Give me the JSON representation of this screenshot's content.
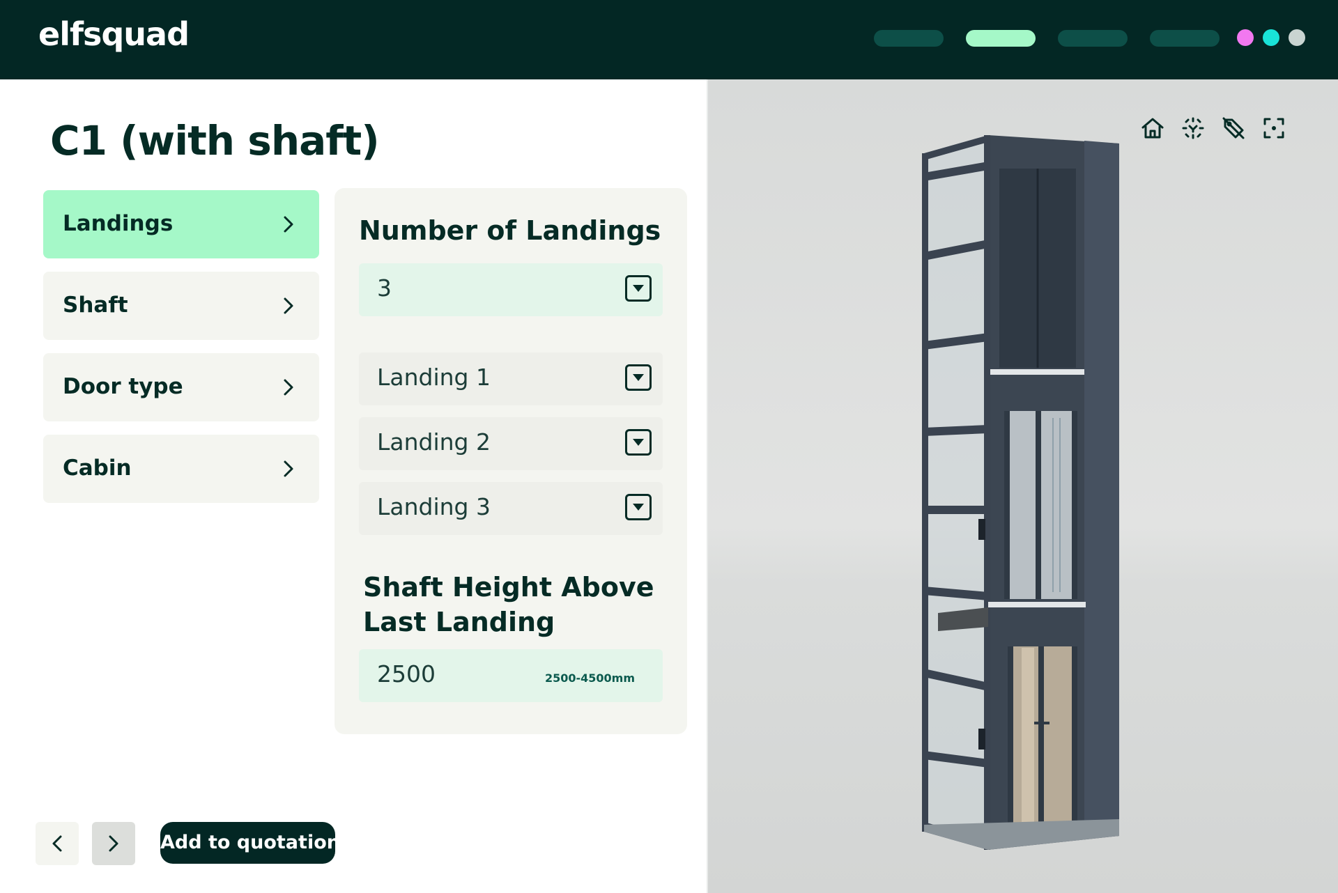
{
  "header": {
    "logo": "elfsquad",
    "steps": [
      "step-1",
      "step-2",
      "step-3",
      "step-4"
    ],
    "active_step": 1,
    "status_dots": [
      "#f278f0",
      "#19e3d8",
      "#c9d4d1"
    ]
  },
  "page": {
    "title": "C1 (with shaft)"
  },
  "sidebar": {
    "items": [
      {
        "label": "Landings",
        "active": true
      },
      {
        "label": "Shaft",
        "active": false
      },
      {
        "label": "Door type",
        "active": false
      },
      {
        "label": "Cabin",
        "active": false
      }
    ]
  },
  "options": {
    "landings_title": "Number of Landings",
    "landings_count": "3",
    "landing_fields": [
      "Landing 1",
      "Landing 2",
      "Landing 3"
    ],
    "shaft_title_line1": "Shaft Height Above",
    "shaft_title_line2": "Last Landing",
    "shaft_height_value": "2500",
    "shaft_height_range": "2500-4500mm"
  },
  "footer": {
    "prev_icon": "chevron-left-icon",
    "next_icon": "chevron-right-icon",
    "add_to_quotation": "Add to quotation"
  },
  "viewer": {
    "tools": [
      "home-icon",
      "focus-icon",
      "hide-labels-icon",
      "fullscreen-icon"
    ]
  },
  "colors": {
    "brand_dark": "#032724",
    "accent_mint": "#a5f8c8",
    "panel_bg": "#f4f5f0",
    "frame_steel": "#3c4652"
  }
}
